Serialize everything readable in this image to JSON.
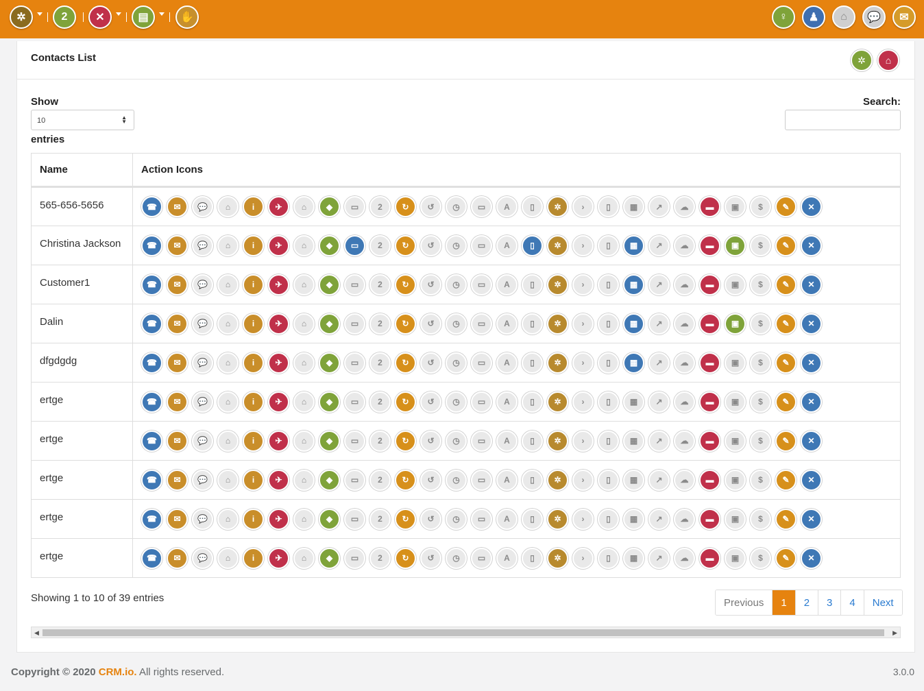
{
  "topbar": {
    "left_icons": [
      {
        "icon": "gears-icon",
        "color": "#8b6b1f",
        "caret": true
      },
      {
        "icon": "calendar-icon",
        "color": "#7fa33a",
        "caret": false
      },
      {
        "icon": "tools-icon",
        "color": "#c0304a",
        "caret": true
      },
      {
        "icon": "contact-card-icon",
        "color": "#7fa33a",
        "caret": true
      },
      {
        "icon": "handshake-icon",
        "color": "#c7902d",
        "caret": false
      }
    ],
    "right_icons": [
      {
        "icon": "user-icon",
        "color": "#7fa33a"
      },
      {
        "icon": "team-icon",
        "color": "#3f6fb0"
      },
      {
        "icon": "building-icon",
        "color": "#cfcfcf"
      },
      {
        "icon": "chat-icon",
        "color": "#cfcfcf"
      },
      {
        "icon": "mail-icon",
        "color": "#d59b2a"
      }
    ]
  },
  "page": {
    "title": "Contacts List",
    "header_icons": [
      {
        "icon": "gear-ring-icon",
        "color": "#7fa33a"
      },
      {
        "icon": "home-icon",
        "color": "#c0304a"
      }
    ]
  },
  "controls": {
    "show_label": "Show",
    "page_size": "10",
    "entries_label": "entries",
    "search_label": "Search:",
    "search_value": ""
  },
  "table": {
    "columns": [
      "Name",
      "Action Icons"
    ],
    "palette": {
      "blue": "#3f78b5",
      "gold": "#c98e2a",
      "gray": "#e9e9e9",
      "red": "#c0304a",
      "green": "#7fa33a",
      "amber": "#d7901b",
      "brown": "#b88a2e"
    },
    "icon_names": [
      "phone-icon",
      "mail-icon",
      "chat-icon",
      "building-icon",
      "info-icon",
      "plane-icon",
      "house-icon",
      "tag-icon",
      "open-sign-icon",
      "calendar-icon",
      "refresh-icon",
      "back-arrow-icon",
      "stopwatch-icon",
      "closed-sign-icon",
      "abc-icon",
      "document-icon",
      "gears-icon",
      "arrow-right-icon",
      "mouse-icon",
      "bricks-icon",
      "chart-icon",
      "cloud-icon",
      "card-icon",
      "photo-icon",
      "dollar-icon",
      "coupon-icon",
      "cancel-icon"
    ],
    "glyphs": [
      "☎",
      "✉",
      "💬",
      "⌂",
      "i",
      "✈",
      "⌂",
      "◆",
      "▭",
      "2",
      "↻",
      "↺",
      "◷",
      "▭",
      "A",
      "▯",
      "✲",
      "›",
      "▯",
      "▦",
      "↗",
      "☁",
      "▬",
      "▣",
      "$",
      "✎",
      "✕"
    ],
    "base_colors": [
      "blue",
      "gold",
      "gray",
      "gray",
      "gold",
      "red",
      "gray",
      "green",
      "gray",
      "gray",
      "amber",
      "gray",
      "gray",
      "gray",
      "gray",
      "gray",
      "brown",
      "gray",
      "gray",
      "gray",
      "gray",
      "gray",
      "red",
      "gray",
      "gray",
      "amber",
      "blue"
    ],
    "rows": [
      {
        "name": "565-656-5656",
        "active": []
      },
      {
        "name": "Christina Jackson",
        "active": [
          8,
          15,
          19,
          23
        ]
      },
      {
        "name": "Customer1",
        "active": [
          19
        ]
      },
      {
        "name": "Dalin",
        "active": [
          19,
          23
        ]
      },
      {
        "name": "dfgdgdg",
        "active": [
          19
        ]
      },
      {
        "name": "ertge",
        "active": []
      },
      {
        "name": "ertge",
        "active": []
      },
      {
        "name": "ertge",
        "active": []
      },
      {
        "name": "ertge",
        "active": []
      },
      {
        "name": "ertge",
        "active": []
      }
    ],
    "active_colors": {
      "8": "blue",
      "15": "blue",
      "19": "blue",
      "23": "green"
    }
  },
  "pagination": {
    "summary": "Showing 1 to 10 of 39 entries",
    "previous": "Previous",
    "pages": [
      "1",
      "2",
      "3",
      "4"
    ],
    "current": "1",
    "next": "Next"
  },
  "footer": {
    "copyright": "Copyright © 2020",
    "brand": "CRM.io.",
    "rights": "All rights reserved.",
    "version": "3.0.0"
  }
}
